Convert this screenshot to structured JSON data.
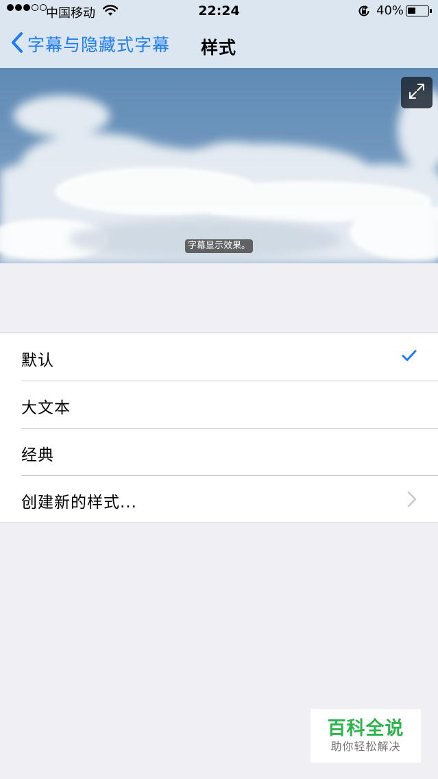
{
  "status_bar": {
    "signal_dots": [
      "full",
      "full",
      "full",
      "empty",
      "empty"
    ],
    "carrier": "中国移动",
    "time": "22:24",
    "battery_percent": "40%",
    "battery_level": 0.4
  },
  "nav": {
    "back_label": "字幕与隐藏式字幕",
    "title": "样式"
  },
  "preview": {
    "caption": "字幕显示效果。"
  },
  "styles": {
    "items": [
      {
        "label": "默认",
        "selected": true
      },
      {
        "label": "大文本",
        "selected": false
      },
      {
        "label": "经典",
        "selected": false
      },
      {
        "label": "创建新的样式...",
        "disclosure": true
      }
    ]
  },
  "watermark": {
    "title": "百科全说",
    "subtitle": "助你轻松解决"
  },
  "colors": {
    "accent": "#1d7cf2",
    "watermark_green": "#2bb54a",
    "background": "#efeff4"
  }
}
